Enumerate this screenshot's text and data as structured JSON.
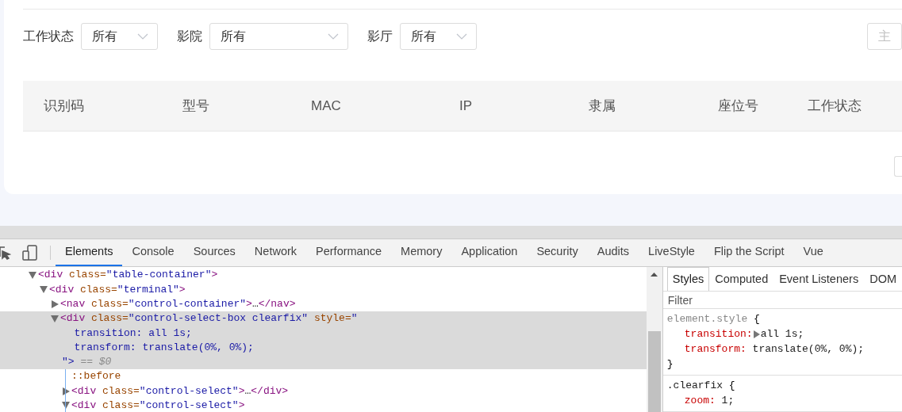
{
  "filters": [
    {
      "label": "工作状态",
      "value": "所有",
      "kind": "narrow"
    },
    {
      "label": "影院",
      "value": "所有",
      "kind": "wide"
    },
    {
      "label": "影厅",
      "value": "所有",
      "kind": "narrow"
    }
  ],
  "theme_button": {
    "label": "主"
  },
  "table": {
    "columns": [
      "识别码",
      "型号",
      "MAC",
      "IP",
      "隶属",
      "座位号",
      "工作状态"
    ]
  },
  "devtools": {
    "tabs": [
      {
        "label": "Elements",
        "selected": true
      },
      {
        "label": "Console",
        "selected": false
      },
      {
        "label": "Sources",
        "selected": false
      },
      {
        "label": "Network",
        "selected": false
      },
      {
        "label": "Performance",
        "selected": false
      },
      {
        "label": "Memory",
        "selected": false
      },
      {
        "label": "Application",
        "selected": false
      },
      {
        "label": "Security",
        "selected": false
      },
      {
        "label": "Audits",
        "selected": false
      },
      {
        "label": "LiveStyle",
        "selected": false
      },
      {
        "label": "Flip the Script",
        "selected": false
      },
      {
        "label": "Vue",
        "selected": false
      }
    ],
    "dom_tree": [
      {
        "kind": "element",
        "expanded": true,
        "selected": false,
        "lines": [
          [
            {
              "kind": "tag",
              "text": "<div"
            },
            {
              "kind": "attr",
              "text": " class="
            },
            {
              "kind": "value",
              "text": "\"table-container\""
            },
            {
              "kind": "tag",
              "text": ">"
            }
          ]
        ],
        "children": [
          {
            "kind": "element",
            "expanded": true,
            "selected": false,
            "lines": [
              [
                {
                  "kind": "tag",
                  "text": "<div"
                },
                {
                  "kind": "attr",
                  "text": " class="
                },
                {
                  "kind": "value",
                  "text": "\"terminal\""
                },
                {
                  "kind": "tag",
                  "text": ">"
                }
              ]
            ],
            "children": [
              {
                "kind": "element",
                "expanded": false,
                "selected": false,
                "lines": [
                  [
                    {
                      "kind": "tag",
                      "text": "<nav"
                    },
                    {
                      "kind": "attr",
                      "text": " class="
                    },
                    {
                      "kind": "value",
                      "text": "\"control-container\""
                    },
                    {
                      "kind": "tag",
                      "text": ">"
                    },
                    {
                      "kind": "plain",
                      "text": "…"
                    },
                    {
                      "kind": "tag",
                      "text": "</nav>"
                    }
                  ]
                ]
              },
              {
                "kind": "element",
                "expanded": true,
                "selected": true,
                "lines": [
                  [
                    {
                      "kind": "tag",
                      "text": "<div"
                    },
                    {
                      "kind": "attr",
                      "text": " class="
                    },
                    {
                      "kind": "value",
                      "text": "\"control-select-box clearfix\""
                    },
                    {
                      "kind": "attr",
                      "text": " style="
                    },
                    {
                      "kind": "value",
                      "text": "\""
                    }
                  ],
                  [
                    {
                      "kind": "value",
                      "text": "  transition: all 1s;"
                    }
                  ],
                  [
                    {
                      "kind": "value",
                      "text": "  transform: translate(0%, 0%);"
                    }
                  ],
                  [
                    {
                      "kind": "value",
                      "text": "\">"
                    },
                    {
                      "kind": "hint",
                      "text": " == $0"
                    }
                  ]
                ],
                "children": [
                  {
                    "kind": "pseudo",
                    "lines": [
                      [
                        {
                          "kind": "attr",
                          "text": "::before"
                        }
                      ]
                    ]
                  },
                  {
                    "kind": "element",
                    "expanded": false,
                    "selected": false,
                    "lines": [
                      [
                        {
                          "kind": "tag",
                          "text": "<div"
                        },
                        {
                          "kind": "attr",
                          "text": " class="
                        },
                        {
                          "kind": "value",
                          "text": "\"control-select\""
                        },
                        {
                          "kind": "tag",
                          "text": ">"
                        },
                        {
                          "kind": "plain",
                          "text": "…"
                        },
                        {
                          "kind": "tag",
                          "text": "</div>"
                        }
                      ]
                    ]
                  },
                  {
                    "kind": "element",
                    "expanded": true,
                    "selected": false,
                    "lines": [
                      [
                        {
                          "kind": "tag",
                          "text": "<div"
                        },
                        {
                          "kind": "attr",
                          "text": " class="
                        },
                        {
                          "kind": "value",
                          "text": "\"control-select\""
                        },
                        {
                          "kind": "tag",
                          "text": ">"
                        }
                      ]
                    ]
                  }
                ]
              }
            ]
          }
        ]
      }
    ],
    "side_tabs": [
      {
        "label": "Styles",
        "selected": true
      },
      {
        "label": "Computed",
        "selected": false
      },
      {
        "label": "Event Listeners",
        "selected": false
      },
      {
        "label": "DOM",
        "selected": false
      }
    ],
    "filter": {
      "placeholder": "Filter"
    },
    "rules": [
      {
        "selector": "element.style",
        "open": "{",
        "close": "}",
        "declarations": [
          {
            "property": "transition:",
            "value": "all 1s;",
            "expandable": true
          },
          {
            "property": "transform:",
            "value": " translate(0%, 0%);",
            "expandable": false
          }
        ]
      },
      {
        "selector": ".clearfix",
        "open": "{",
        "declarations": [
          {
            "property": "zoom:",
            "value": " 1;",
            "expandable": false
          }
        ]
      }
    ]
  }
}
